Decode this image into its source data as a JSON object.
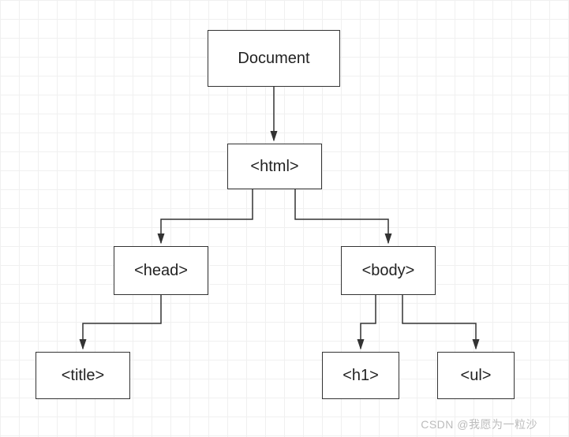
{
  "nodes": {
    "document": "Document",
    "html": "<html>",
    "head": "<head>",
    "body": "<body>",
    "title": "<title>",
    "h1": "<h1>",
    "ul": "<ul>"
  },
  "watermark": "CSDN @我愿为一粒沙"
}
